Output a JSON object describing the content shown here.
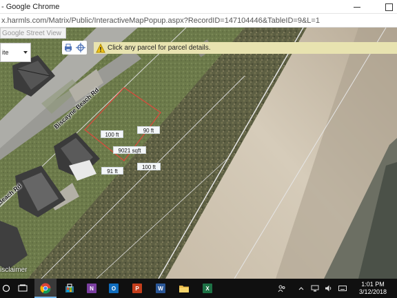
{
  "window": {
    "title": "- Google Chrome"
  },
  "address_bar": {
    "url": "x.harmls.com/Matrix/Public/InteractiveMapPopup.aspx?RecordID=147104446&TableID=9&L=1"
  },
  "map": {
    "street_view_button": "Google Street View",
    "layer_select_value": "ite",
    "hint": "Click any parcel for parcel details.",
    "parcel": {
      "area": "9021 sqft",
      "dimensions": [
        "100 ft",
        "90 ft",
        "91 ft",
        "100 ft"
      ]
    },
    "road_labels": [
      "Biscayne Beach Rd",
      "Beach Rd"
    ],
    "disclaimer": "isclaimer",
    "colors": {
      "parcel_outline": "#e0473b",
      "hint_background": "#e8e3b0",
      "parcel_line": "#d9d9d9"
    }
  },
  "taskbar": {
    "apps": [
      {
        "name": "search",
        "icon": "search-ring-icon"
      },
      {
        "name": "task-view",
        "icon": "task-view-icon"
      },
      {
        "name": "chrome",
        "icon": "chrome-icon",
        "active": true
      },
      {
        "name": "store",
        "icon": "store-icon"
      },
      {
        "name": "onenote",
        "icon": "onenote-icon",
        "letter": "N",
        "color": "#7b3fa0"
      },
      {
        "name": "outlook",
        "icon": "outlook-icon",
        "letter": "O",
        "color": "#0f6cbd"
      },
      {
        "name": "powerpoint",
        "icon": "powerpoint-icon",
        "letter": "P",
        "color": "#c43e1c"
      },
      {
        "name": "word",
        "icon": "word-icon",
        "letter": "W",
        "color": "#2b5797"
      },
      {
        "name": "file-explorer",
        "icon": "folder-icon"
      },
      {
        "name": "excel",
        "icon": "excel-icon",
        "letter": "X",
        "color": "#1d7145"
      }
    ],
    "time": "1:01 PM",
    "date": "3/12/2018"
  }
}
